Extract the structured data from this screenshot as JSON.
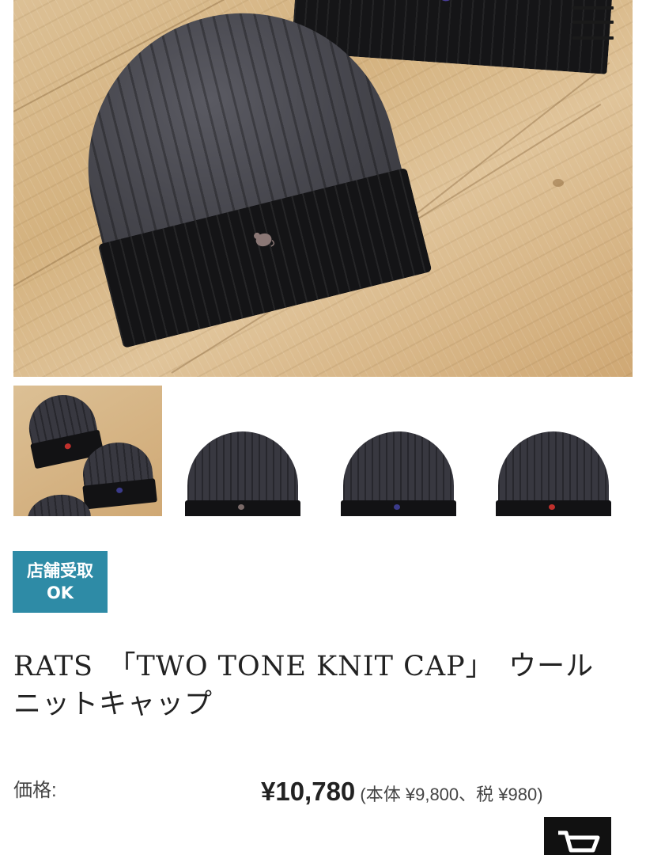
{
  "menu": {
    "icon": "hamburger-menu-icon"
  },
  "gallery": {
    "main_image": "two-tone-knit-cap-photo",
    "thumbnails": [
      {
        "name": "group-photo",
        "logo_color": "#c0302c"
      },
      {
        "name": "gray-logo-cap",
        "logo_color": "#7a6a68"
      },
      {
        "name": "navy-logo-cap",
        "logo_color": "#3a3a8a"
      },
      {
        "name": "red-logo-cap",
        "logo_color": "#c0302c"
      }
    ]
  },
  "badge": {
    "line1": "店舗受取",
    "line2": "OK",
    "color": "#2e8ba6"
  },
  "product": {
    "title": "RATS　「TWO TONE KNIT CAP」　ウールニットキャップ"
  },
  "price": {
    "label": "価格:",
    "amount": "¥10,780",
    "detail": "(本体 ¥9,800、税 ¥980)"
  },
  "cart": {
    "icon": "shopping-cart-icon"
  }
}
